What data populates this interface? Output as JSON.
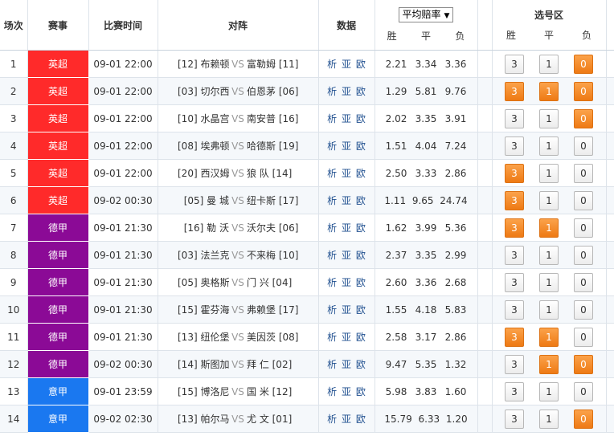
{
  "colors": {
    "epl": "#ff2a2a",
    "bundesliga": "#8b0a96",
    "seriea": "#1a78f0",
    "selected": "#ff8a1c"
  },
  "header": {
    "num": "场次",
    "league": "赛事",
    "time": "比赛时间",
    "match": "对阵",
    "data": "数据",
    "odds_select": "平均赔率",
    "odds_select_icon": "dropdown-arrow",
    "win": "胜",
    "draw": "平",
    "loss": "负",
    "pick_area": "选号区",
    "pick_win": "胜",
    "pick_draw": "平",
    "pick_loss": "负"
  },
  "vs_label": "VS",
  "data_links": [
    "析",
    "亚",
    "欧"
  ],
  "matches": [
    {
      "num": "1",
      "league": "英超",
      "lc": "epl",
      "time": "09-01 22:00",
      "home": "[12] 布赖顿",
      "away": "富勒姆 [11]",
      "w": "2.21",
      "d": "3.34",
      "l": "3.36",
      "p": [
        "3",
        "1",
        "0"
      ],
      "sel": [
        false,
        false,
        true
      ]
    },
    {
      "num": "2",
      "league": "英超",
      "lc": "epl",
      "time": "09-01 22:00",
      "home": "[03] 切尔西",
      "away": "伯恩茅 [06]",
      "w": "1.29",
      "d": "5.81",
      "l": "9.76",
      "p": [
        "3",
        "1",
        "0"
      ],
      "sel": [
        true,
        true,
        true
      ]
    },
    {
      "num": "3",
      "league": "英超",
      "lc": "epl",
      "time": "09-01 22:00",
      "home": "[10] 水晶宫",
      "away": "南安普 [16]",
      "w": "2.02",
      "d": "3.35",
      "l": "3.91",
      "p": [
        "3",
        "1",
        "0"
      ],
      "sel": [
        false,
        false,
        true
      ]
    },
    {
      "num": "4",
      "league": "英超",
      "lc": "epl",
      "time": "09-01 22:00",
      "home": "[08] 埃弗顿",
      "away": "哈德斯 [19]",
      "w": "1.51",
      "d": "4.04",
      "l": "7.24",
      "p": [
        "3",
        "1",
        "0"
      ],
      "sel": [
        false,
        false,
        false
      ]
    },
    {
      "num": "5",
      "league": "英超",
      "lc": "epl",
      "time": "09-01 22:00",
      "home": "[20] 西汉姆",
      "away": "狼 队 [14]",
      "w": "2.50",
      "d": "3.33",
      "l": "2.86",
      "p": [
        "3",
        "1",
        "0"
      ],
      "sel": [
        true,
        false,
        false
      ]
    },
    {
      "num": "6",
      "league": "英超",
      "lc": "epl",
      "time": "09-02 00:30",
      "home": "[05] 曼 城",
      "away": "纽卡斯 [17]",
      "w": "1.11",
      "d": "9.65",
      "l": "24.74",
      "p": [
        "3",
        "1",
        "0"
      ],
      "sel": [
        true,
        false,
        false
      ]
    },
    {
      "num": "7",
      "league": "德甲",
      "lc": "bundesliga",
      "time": "09-01 21:30",
      "home": "[16] 勒 沃",
      "away": "沃尔夫 [06]",
      "w": "1.62",
      "d": "3.99",
      "l": "5.36",
      "p": [
        "3",
        "1",
        "0"
      ],
      "sel": [
        true,
        true,
        false
      ]
    },
    {
      "num": "8",
      "league": "德甲",
      "lc": "bundesliga",
      "time": "09-01 21:30",
      "home": "[03] 法兰克",
      "away": "不来梅 [10]",
      "w": "2.37",
      "d": "3.35",
      "l": "2.99",
      "p": [
        "3",
        "1",
        "0"
      ],
      "sel": [
        false,
        false,
        false
      ]
    },
    {
      "num": "9",
      "league": "德甲",
      "lc": "bundesliga",
      "time": "09-01 21:30",
      "home": "[05] 奥格斯",
      "away": "门 兴 [04]",
      "w": "2.60",
      "d": "3.36",
      "l": "2.68",
      "p": [
        "3",
        "1",
        "0"
      ],
      "sel": [
        false,
        false,
        false
      ]
    },
    {
      "num": "10",
      "league": "德甲",
      "lc": "bundesliga",
      "time": "09-01 21:30",
      "home": "[15] 霍芬海",
      "away": "弗赖堡 [17]",
      "w": "1.55",
      "d": "4.18",
      "l": "5.83",
      "p": [
        "3",
        "1",
        "0"
      ],
      "sel": [
        false,
        false,
        false
      ]
    },
    {
      "num": "11",
      "league": "德甲",
      "lc": "bundesliga",
      "time": "09-01 21:30",
      "home": "[13] 纽伦堡",
      "away": "美因茨 [08]",
      "w": "2.58",
      "d": "3.17",
      "l": "2.86",
      "p": [
        "3",
        "1",
        "0"
      ],
      "sel": [
        true,
        true,
        false
      ]
    },
    {
      "num": "12",
      "league": "德甲",
      "lc": "bundesliga",
      "time": "09-02 00:30",
      "home": "[14] 斯图加",
      "away": "拜 仁 [02]",
      "w": "9.47",
      "d": "5.35",
      "l": "1.32",
      "p": [
        "3",
        "1",
        "0"
      ],
      "sel": [
        false,
        true,
        true
      ]
    },
    {
      "num": "13",
      "league": "意甲",
      "lc": "seriea",
      "time": "09-01 23:59",
      "home": "[15] 博洛尼",
      "away": "国 米 [12]",
      "w": "5.98",
      "d": "3.83",
      "l": "1.60",
      "p": [
        "3",
        "1",
        "0"
      ],
      "sel": [
        false,
        false,
        false
      ]
    },
    {
      "num": "14",
      "league": "意甲",
      "lc": "seriea",
      "time": "09-02 02:30",
      "home": "[13] 帕尔马",
      "away": "尤 文 [01]",
      "w": "15.79",
      "d": "6.33",
      "l": "1.20",
      "p": [
        "3",
        "1",
        "0"
      ],
      "sel": [
        false,
        false,
        true
      ]
    }
  ]
}
